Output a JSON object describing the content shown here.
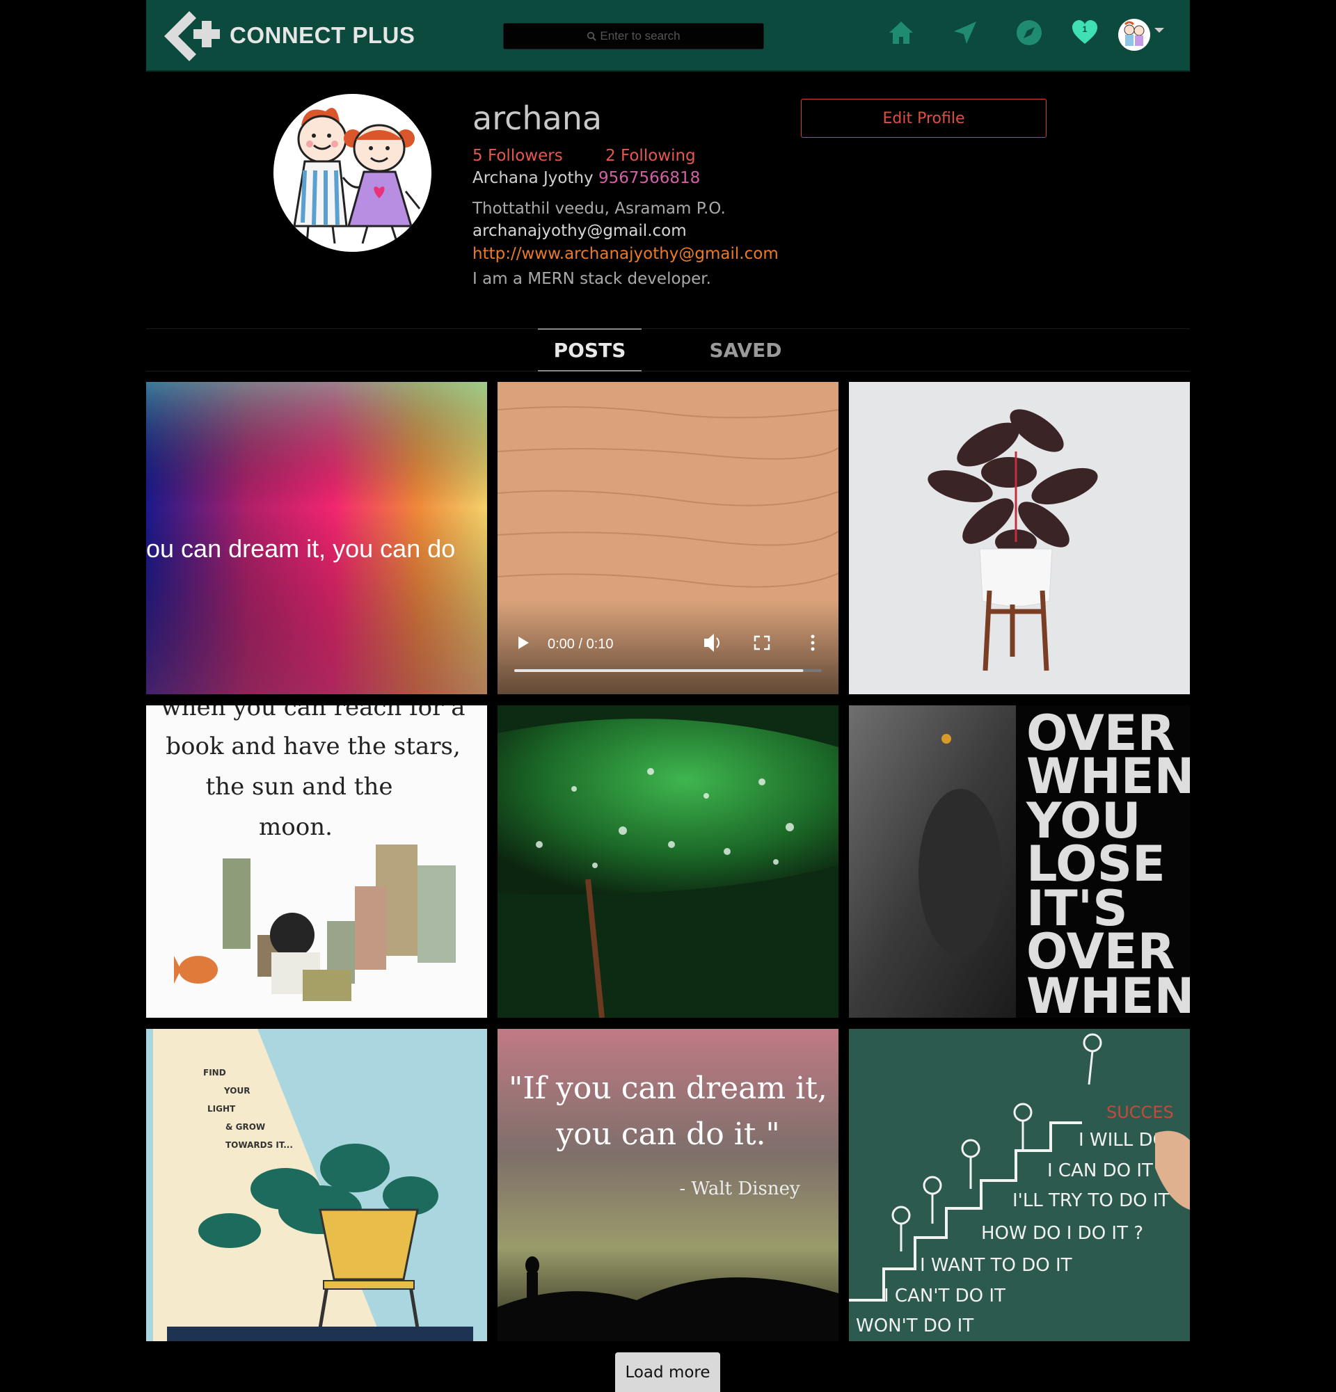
{
  "header": {
    "brand": "CONNECT PLUS",
    "search_placeholder": "Enter to search",
    "notification_count": "1",
    "accent_color": "#0b4a3d",
    "icons": [
      "home-icon",
      "send-icon",
      "explore-icon",
      "heart-icon",
      "avatar"
    ]
  },
  "profile": {
    "username": "archana",
    "followers": "5 Followers",
    "following": "2 Following",
    "full_name": "Archana Jyothy",
    "phone": "9567566818",
    "address": "Thottathil veedu, Asramam P.O.",
    "email": "archanajyothy@gmail.com",
    "website": "http://www.archanajyothy@gmail.com",
    "bio": "I am a MERN stack developer.",
    "edit_button": "Edit Profile"
  },
  "tabs": [
    {
      "label": "POSTS",
      "active": true
    },
    {
      "label": "SAVED",
      "active": false
    }
  ],
  "posts": [
    {
      "kind": "image",
      "caption": "ou can dream it, you can do"
    },
    {
      "kind": "video",
      "time": "0:00 / 0:10",
      "progress": 0.94
    },
    {
      "kind": "image",
      "caption": ""
    },
    {
      "kind": "image",
      "lines": [
        "when you can reach for a",
        "book and have the stars,",
        "the sun and the",
        "moon."
      ]
    },
    {
      "kind": "image",
      "caption": ""
    },
    {
      "kind": "image",
      "lines": [
        "OVER",
        "WHEN",
        "YOU",
        "LOSE",
        "IT'S",
        "OVER",
        "WHEN"
      ]
    },
    {
      "kind": "image",
      "lines": [
        "FIND",
        "YOUR",
        "LIGHT",
        "& GROW",
        "TOWARDS IT..."
      ]
    },
    {
      "kind": "image",
      "lines": [
        "\"If you can dream it,",
        "you can do it.\"",
        "- Walt Disney"
      ]
    },
    {
      "kind": "image",
      "lines": [
        "SUCCES",
        "I WILL DO",
        "I CAN DO IT",
        "I'LL TRY TO DO IT",
        "HOW DO I DO IT ?",
        "I WANT TO DO IT",
        "I CAN'T DO IT",
        "WON'T DO IT"
      ]
    }
  ],
  "load_more": "Load more"
}
